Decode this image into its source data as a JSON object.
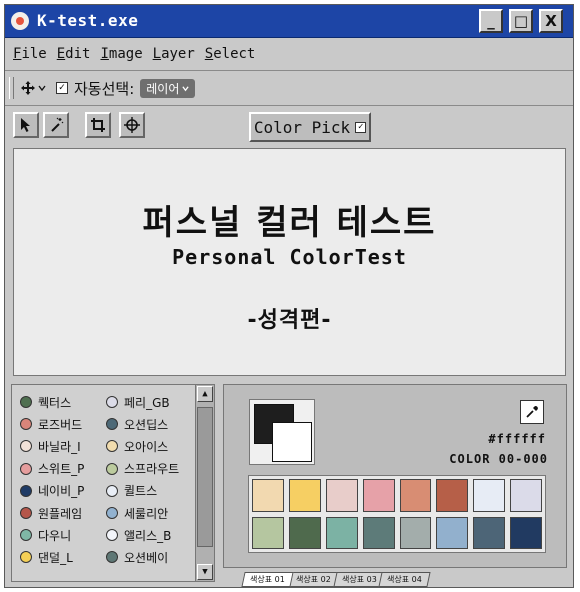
{
  "window": {
    "title": "K-test.exe"
  },
  "titlebar": {
    "minimize": "_",
    "maximize": "□",
    "close": "X"
  },
  "menu": [
    {
      "first": "F",
      "rest": "ile"
    },
    {
      "first": "E",
      "rest": "dit"
    },
    {
      "first": "I",
      "rest": "mage"
    },
    {
      "first": "L",
      "rest": "ayer"
    },
    {
      "first": "S",
      "rest": "elect"
    }
  ],
  "options": {
    "move_icon": "move-arrows",
    "auto_select_label": "자동선택:",
    "layer_select_value": "레이어",
    "auto_select_checked": true
  },
  "tools": [
    "arrow",
    "magic-wand",
    "crop",
    "crosshair"
  ],
  "color_pick": {
    "label": "Color Pick",
    "checked": true
  },
  "canvas": {
    "title_ko": "퍼스널 컬러 테스트",
    "title_en": "Personal ColorTest",
    "subtitle": "-성격편-"
  },
  "list_left": [
    {
      "label": "퀙터스",
      "color": "#4f6f50"
    },
    {
      "label": "로즈버드",
      "color": "#d9857a"
    },
    {
      "label": "바닐라_I",
      "color": "#f2e2d8"
    },
    {
      "label": "스위트_P",
      "color": "#e59d9d"
    },
    {
      "label": "네이비_P",
      "color": "#1f3b66"
    },
    {
      "label": "원플레임",
      "color": "#b5564a"
    },
    {
      "label": "다우니",
      "color": "#7fb7a5"
    },
    {
      "label": "댄덜_L",
      "color": "#f4cf56"
    }
  ],
  "list_right": [
    {
      "label": "페리_GB",
      "color": "#dcdce8"
    },
    {
      "label": "오션딥스",
      "color": "#4d6977"
    },
    {
      "label": "오아이스",
      "color": "#f1dcae"
    },
    {
      "label": "스프라우트",
      "color": "#bccb9e"
    },
    {
      "label": "퀼트스",
      "color": "#e9eef6"
    },
    {
      "label": "세룰리안",
      "color": "#92b2d0"
    },
    {
      "label": "앨리스_B",
      "color": "#f3f5fa"
    },
    {
      "label": "오션베이",
      "color": "#5e7775"
    }
  ],
  "palette": {
    "hex": "#ffffff",
    "color_code": "COLOR 00-000",
    "foreground": "#1e1e1e",
    "background": "#ffffff",
    "swatches": [
      "#f2d9b0",
      "#f6cf63",
      "#e8cdca",
      "#e6a1a8",
      "#d88d73",
      "#b65f48",
      "#e7ecf5",
      "#dbdbe9",
      "#b5c6a0",
      "#4f6a4d",
      "#7cb2a4",
      "#5d7b79",
      "#a3adab",
      "#92b0cd",
      "#4d6577",
      "#213a61"
    ]
  },
  "tabs": [
    "색상표 01",
    "색상표 02",
    "색상표 03",
    "색상표 04"
  ]
}
